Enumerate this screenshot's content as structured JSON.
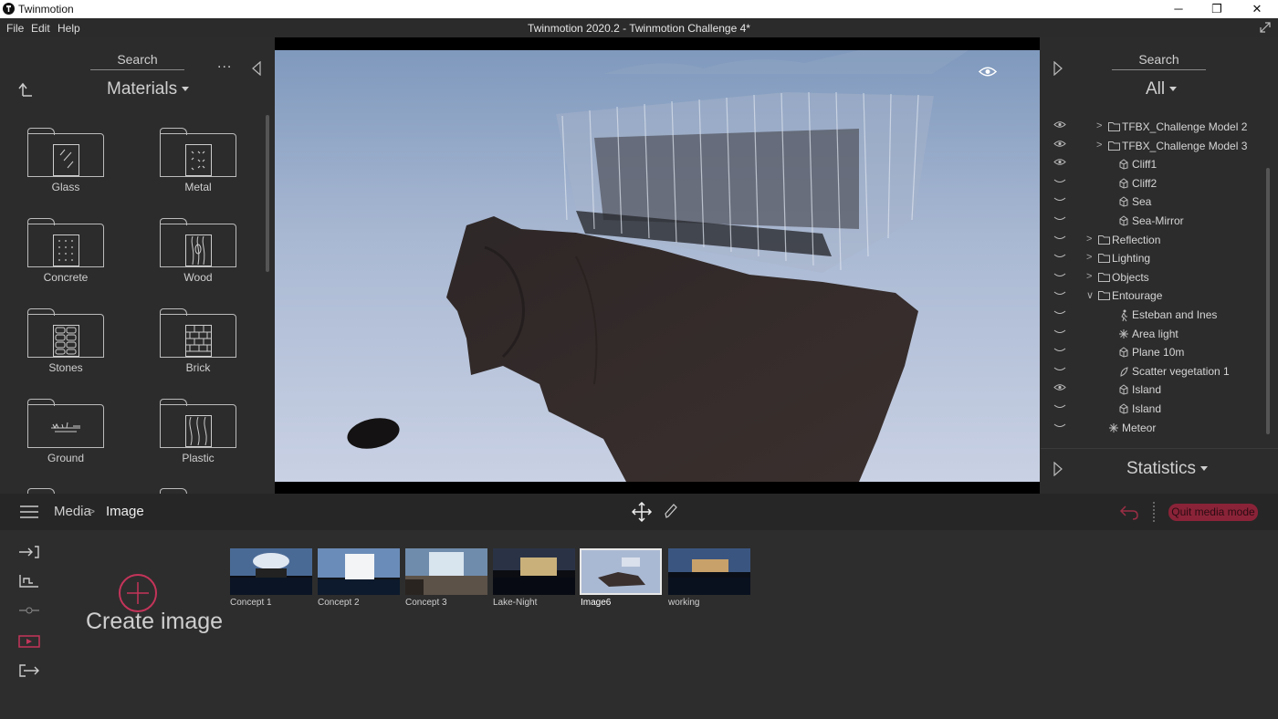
{
  "window": {
    "app_title": "Twinmotion",
    "minimize": "─",
    "maximize": "❐",
    "close": "✕"
  },
  "menu": {
    "file": "File",
    "edit": "Edit",
    "help": "Help",
    "document_title": "Twinmotion 2020.2 - Twinmotion Challenge 4*"
  },
  "library": {
    "search_label": "Search",
    "category": "Materials",
    "more": "...",
    "items": [
      {
        "label": "Glass",
        "icon": "glass-icon"
      },
      {
        "label": "Metal",
        "icon": "metal-icon"
      },
      {
        "label": "Concrete",
        "icon": "concrete-icon"
      },
      {
        "label": "Wood",
        "icon": "wood-icon"
      },
      {
        "label": "Stones",
        "icon": "stones-icon"
      },
      {
        "label": "Brick",
        "icon": "brick-icon"
      },
      {
        "label": "Ground",
        "icon": "ground-icon"
      },
      {
        "label": "Plastic",
        "icon": "plastic-icon"
      }
    ]
  },
  "scene": {
    "search_label": "Search",
    "filter": "All",
    "items": [
      {
        "label": "TFBX_Challenge Model 2",
        "type": "folder",
        "visible": true,
        "expand": ">",
        "indent": 1
      },
      {
        "label": "TFBX_Challenge Model 3",
        "type": "folder",
        "visible": true,
        "expand": ">",
        "indent": 1
      },
      {
        "label": "Cliff1",
        "type": "object",
        "visible": true,
        "expand": "",
        "indent": 2
      },
      {
        "label": "Cliff2",
        "type": "object",
        "visible": false,
        "expand": "",
        "indent": 2
      },
      {
        "label": "Sea",
        "type": "object",
        "visible": false,
        "expand": "",
        "indent": 2
      },
      {
        "label": "Sea-Mirror",
        "type": "object",
        "visible": false,
        "expand": "",
        "indent": 2
      },
      {
        "label": "Reflection",
        "type": "folder",
        "visible": false,
        "expand": ">",
        "indent": 0
      },
      {
        "label": "Lighting",
        "type": "folder",
        "visible": false,
        "expand": ">",
        "indent": 0
      },
      {
        "label": "Objects",
        "type": "folder",
        "visible": false,
        "expand": ">",
        "indent": 0
      },
      {
        "label": "Entourage",
        "type": "folder",
        "visible": false,
        "expand": "∨",
        "indent": 0
      },
      {
        "label": "Esteban and Ines",
        "type": "human",
        "visible": false,
        "expand": "",
        "indent": 2
      },
      {
        "label": "Area light",
        "type": "light",
        "visible": false,
        "expand": "",
        "indent": 2
      },
      {
        "label": "Plane 10m",
        "type": "object",
        "visible": false,
        "expand": "",
        "indent": 2
      },
      {
        "label": "Scatter vegetation 1",
        "type": "vegetation",
        "visible": false,
        "expand": "",
        "indent": 2
      },
      {
        "label": "Island",
        "type": "object",
        "visible": true,
        "expand": "",
        "indent": 2
      },
      {
        "label": "Island",
        "type": "object",
        "visible": false,
        "expand": "",
        "indent": 2
      },
      {
        "label": "Meteor",
        "type": "light",
        "visible": false,
        "expand": "",
        "indent": 1
      }
    ],
    "statistics_label": "Statistics"
  },
  "media": {
    "breadcrumb_root": "Media",
    "breadcrumb_sep": ">",
    "breadcrumb_current": "Image",
    "create_label": "Create image",
    "quit_label": "Quit media mode",
    "thumbnails": [
      {
        "label": "Concept 1",
        "selected": false
      },
      {
        "label": "Concept 2",
        "selected": false
      },
      {
        "label": "Concept 3",
        "selected": false
      },
      {
        "label": "Lake-Night",
        "selected": false
      },
      {
        "label": "Image6",
        "selected": true
      },
      {
        "label": "working",
        "selected": false
      }
    ]
  },
  "colors": {
    "accent": "#c4345a",
    "panel": "#2c2c2c",
    "quit_bg": "#8a2338"
  }
}
